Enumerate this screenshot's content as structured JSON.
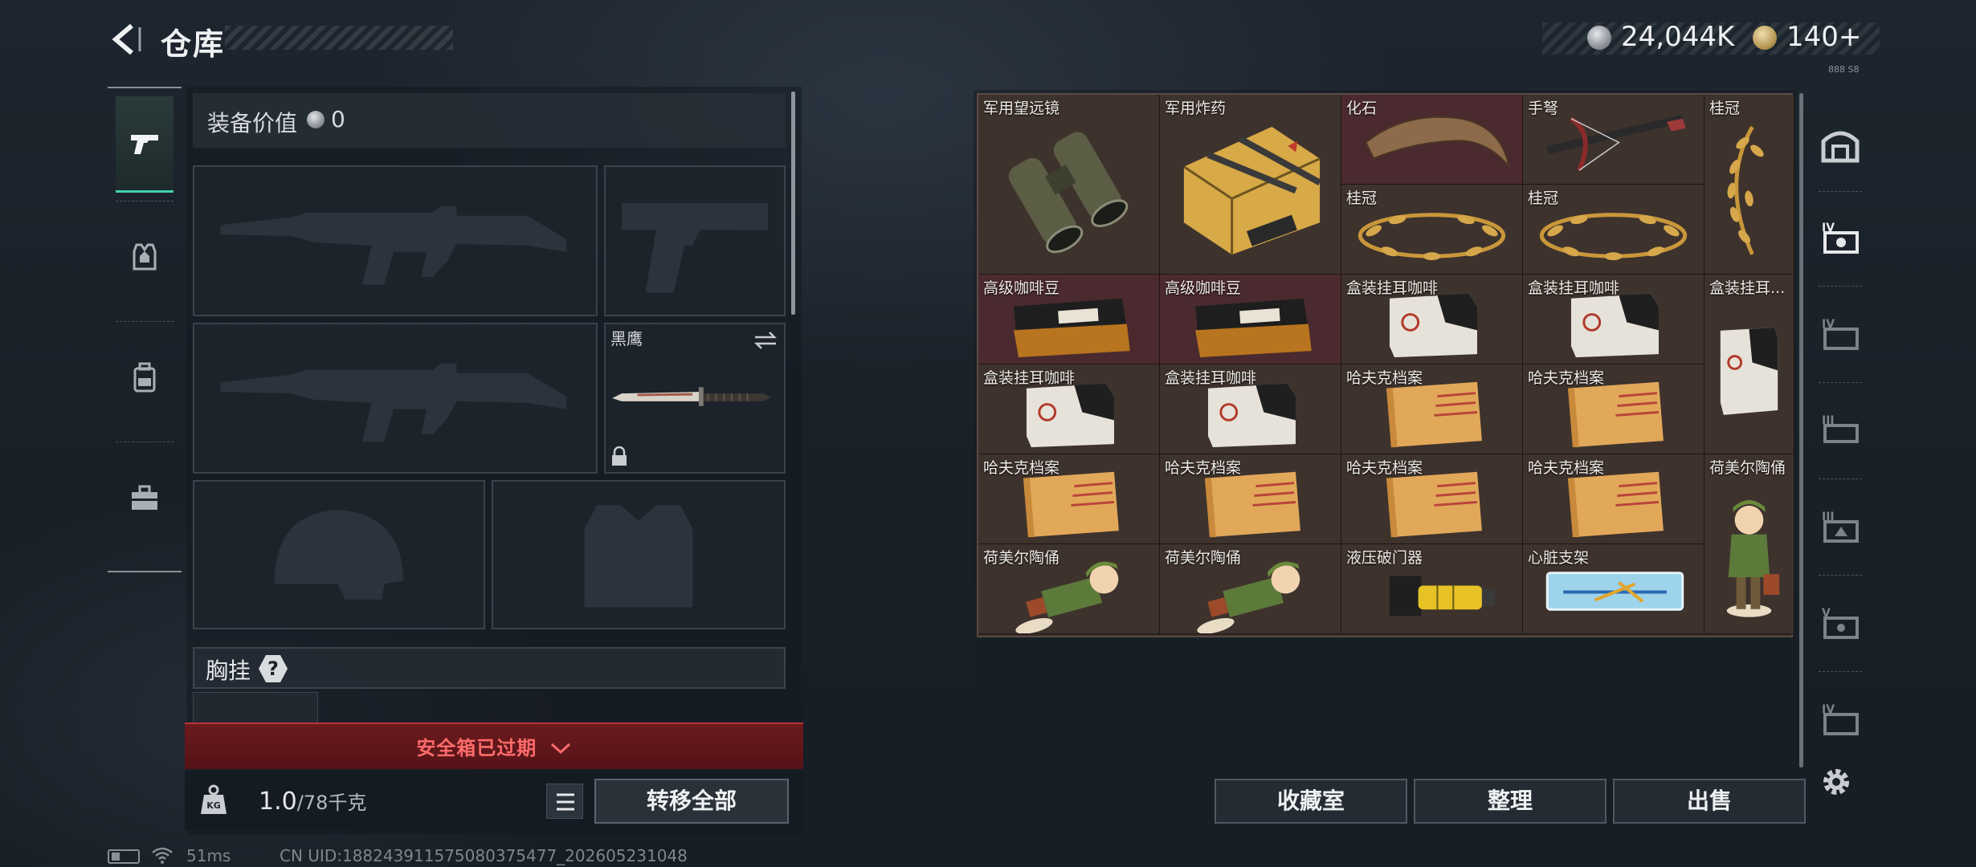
{
  "header": {
    "title": "仓库",
    "currency1": "24,044K",
    "currency2": "140+",
    "corner_note": "888 S8"
  },
  "left_tabs": [
    {
      "name": "weapons",
      "active": true
    },
    {
      "name": "armor",
      "active": false
    },
    {
      "name": "backpack",
      "active": false
    },
    {
      "name": "toolbox",
      "active": false
    }
  ],
  "equipment": {
    "value_label": "装备价值",
    "value": "0",
    "knife_label": "黑鹰",
    "chest_label": "胸挂",
    "chest_help": "?",
    "safe_box_text": "安全箱已过期",
    "weight_value": "1.0",
    "weight_capacity": "/78千克",
    "transfer_all": "转移全部"
  },
  "status": {
    "ping": "51ms",
    "uid": "CN UID:18824391157508037547​7_202605231048"
  },
  "storage": {
    "items": [
      {
        "name": "军用望远镜",
        "icon": "binoculars-icon"
      },
      {
        "name": "军用炸药",
        "icon": "explosive-crate-icon"
      },
      {
        "name": "化石",
        "icon": "fossil-claw-icon"
      },
      {
        "name": "手弩",
        "icon": "hand-crossbow-icon"
      },
      {
        "name": "桂冠",
        "icon": "laurel-crown-icon"
      },
      {
        "name": "桂冠",
        "icon": "laurel-crown-icon"
      },
      {
        "name": "桂冠",
        "icon": "laurel-crown-icon"
      },
      {
        "name": "高级咖啡豆",
        "icon": "coffee-bag-icon"
      },
      {
        "name": "高级咖啡豆",
        "icon": "coffee-bag-icon"
      },
      {
        "name": "盒装挂耳咖啡",
        "icon": "coffee-box-icon"
      },
      {
        "name": "盒装挂耳咖啡",
        "icon": "coffee-box-icon"
      },
      {
        "name": "盒装挂耳...",
        "icon": "coffee-box-icon"
      },
      {
        "name": "盒装挂耳咖啡",
        "icon": "coffee-box-icon"
      },
      {
        "name": "盒装挂耳咖啡",
        "icon": "coffee-box-icon"
      },
      {
        "name": "哈夫克档案",
        "icon": "dossier-icon"
      },
      {
        "name": "哈夫克档案",
        "icon": "dossier-icon"
      },
      {
        "name": "哈夫克档案",
        "icon": "dossier-icon"
      },
      {
        "name": "哈夫克档案",
        "icon": "dossier-icon"
      },
      {
        "name": "哈夫克档案",
        "icon": "dossier-icon"
      },
      {
        "name": "哈夫克档案",
        "icon": "dossier-icon"
      },
      {
        "name": "荷美尔陶俑",
        "icon": "porcelain-figurine-icon"
      },
      {
        "name": "荷美尔陶俑",
        "icon": "porcelain-figurine-icon"
      },
      {
        "name": "荷美尔陶俑",
        "icon": "porcelain-figurine-icon"
      },
      {
        "name": "液压破门器",
        "icon": "hydraulic-breacher-icon"
      },
      {
        "name": "心脏支架",
        "icon": "heart-stent-icon"
      }
    ],
    "buttons": {
      "collection": "收藏室",
      "organize": "整理",
      "sell": "出售"
    }
  },
  "right_tabs": [
    {
      "name": "storage-main"
    },
    {
      "name": "storage-iv-1"
    },
    {
      "name": "storage-iv-2"
    },
    {
      "name": "storage-iii-1"
    },
    {
      "name": "storage-iii-2"
    },
    {
      "name": "storage-v"
    },
    {
      "name": "storage-iv-3"
    }
  ],
  "colors": {
    "accent": "#3fd2b0",
    "warning_red": "#b7343a",
    "cell_red": "#4a2a2e",
    "cell_brown": "#3e322d"
  }
}
